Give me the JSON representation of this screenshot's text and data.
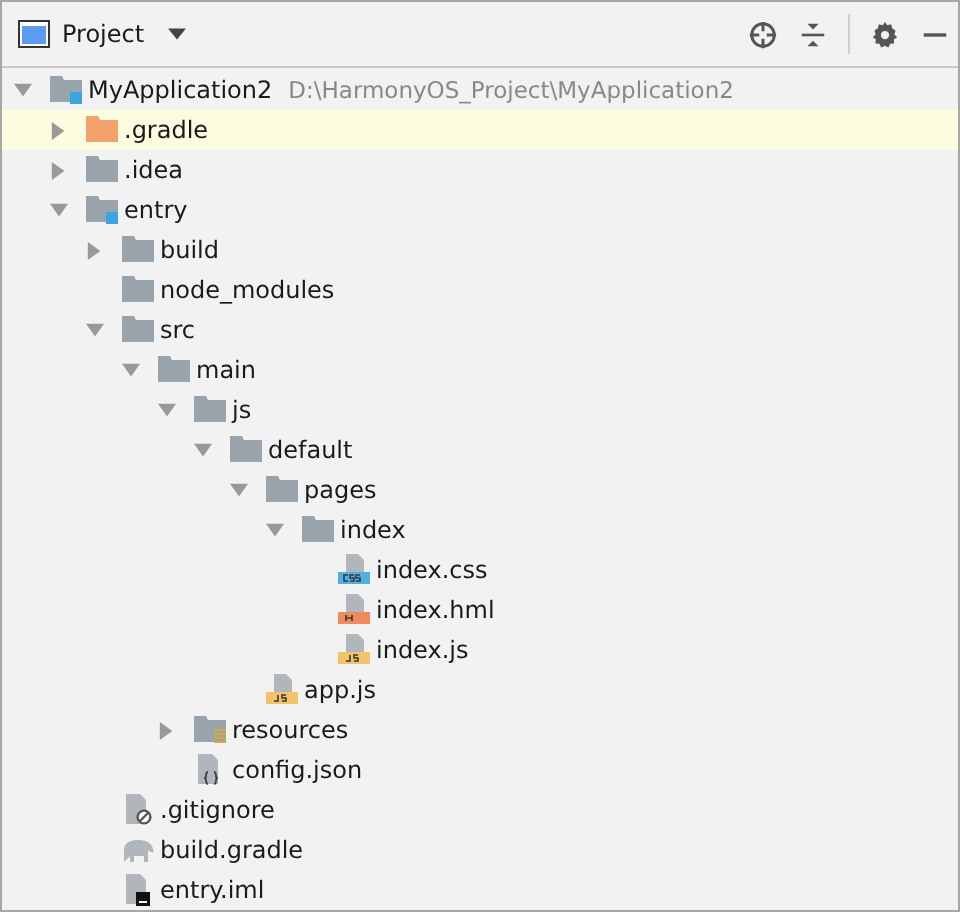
{
  "panel": {
    "title": "Project"
  },
  "tree": [
    {
      "label": "MyApplication2",
      "hint": "D:\\HarmonyOS_Project\\MyApplication2",
      "kind": "module",
      "expanded": true,
      "selected": false,
      "children": [
        {
          "label": ".gradle",
          "kind": "folder-excluded",
          "expanded": false,
          "selected": true
        },
        {
          "label": ".idea",
          "kind": "folder",
          "expanded": false,
          "selected": false
        },
        {
          "label": "entry",
          "kind": "module",
          "expanded": true,
          "selected": false,
          "children": [
            {
              "label": "build",
              "kind": "folder",
              "expanded": false,
              "selected": false
            },
            {
              "label": "node_modules",
              "kind": "folder",
              "selected": false
            },
            {
              "label": "src",
              "kind": "folder",
              "expanded": true,
              "selected": false,
              "children": [
                {
                  "label": "main",
                  "kind": "folder",
                  "expanded": true,
                  "selected": false,
                  "children": [
                    {
                      "label": "js",
                      "kind": "folder",
                      "expanded": true,
                      "selected": false,
                      "children": [
                        {
                          "label": "default",
                          "kind": "folder",
                          "expanded": true,
                          "selected": false,
                          "children": [
                            {
                              "label": "pages",
                              "kind": "folder",
                              "expanded": true,
                              "selected": false,
                              "children": [
                                {
                                  "label": "index",
                                  "kind": "folder",
                                  "expanded": true,
                                  "selected": false,
                                  "children": [
                                    {
                                      "label": "index.css",
                                      "kind": "css",
                                      "selected": false
                                    },
                                    {
                                      "label": "index.hml",
                                      "kind": "hml",
                                      "selected": false
                                    },
                                    {
                                      "label": "index.js",
                                      "kind": "js",
                                      "selected": false
                                    }
                                  ]
                                }
                              ]
                            },
                            {
                              "label": "app.js",
                              "kind": "js",
                              "selected": false
                            }
                          ]
                        }
                      ]
                    },
                    {
                      "label": "resources",
                      "kind": "resources",
                      "expanded": false,
                      "selected": false
                    },
                    {
                      "label": "config.json",
                      "kind": "json",
                      "selected": false
                    }
                  ]
                }
              ]
            },
            {
              "label": ".gitignore",
              "kind": "ignore",
              "selected": false
            },
            {
              "label": "build.gradle",
              "kind": "gradle",
              "selected": false
            },
            {
              "label": "entry.iml",
              "kind": "iml",
              "selected": false
            }
          ]
        }
      ]
    }
  ]
}
